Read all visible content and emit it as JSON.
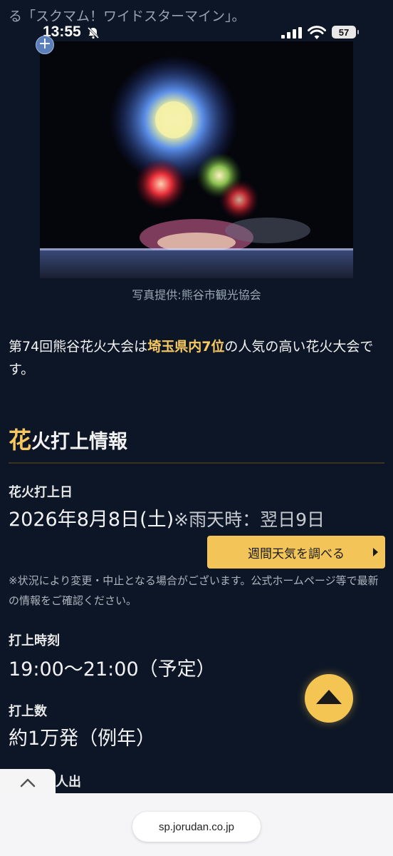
{
  "status": {
    "time": "13:55",
    "battery": "57"
  },
  "top_clip_text": "る「スクマム！ワイドスターマイン」。",
  "photo": {
    "caption": "写真提供:熊谷市観光協会"
  },
  "intro": {
    "part1": "第74回熊谷花火大会は",
    "highlight": "埼玉県内7位",
    "part2": "の人気の高い花火大会です。"
  },
  "section": {
    "title_first": "花",
    "title_rest": "火打上情報"
  },
  "launch_date": {
    "label": "花火打上日",
    "value": "2026年8月8日(土)",
    "rain_note": "※雨天時：翌日9日"
  },
  "weather_button": {
    "label": "週間天気を調べる"
  },
  "notice": "※状況により変更・中止となる場合がございます。公式ホームページ等で最新の情報をご確認ください。",
  "launch_time": {
    "label": "打上時刻",
    "value": "19:00〜21:00（予定）"
  },
  "launch_count": {
    "label": "打上数",
    "value": "約1万発（例年）"
  },
  "next_label_partial": "人出",
  "browser": {
    "url": "sp.jorudan.co.jp"
  },
  "icons": [
    "bell-slash-icon",
    "signal-icon",
    "wifi-icon",
    "battery-icon",
    "plus-icon",
    "back-to-top-icon",
    "chevron-up-icon"
  ],
  "colors": {
    "accent": "#f6c85f",
    "background": "#0c1626",
    "button": "#f3c559"
  }
}
